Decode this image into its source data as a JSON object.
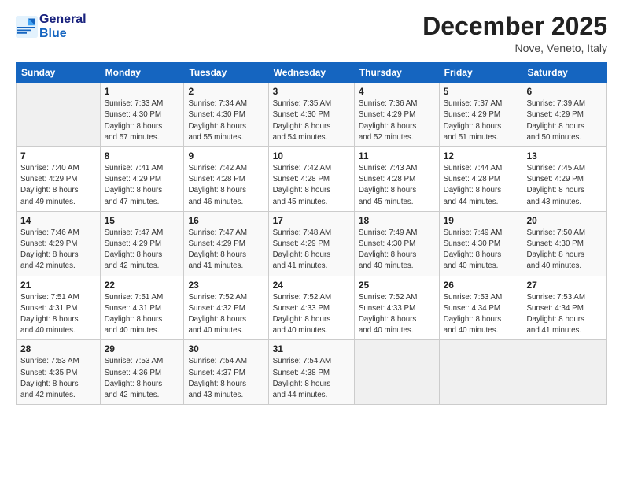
{
  "logo": {
    "line1": "General",
    "line2": "Blue"
  },
  "title": "December 2025",
  "location": "Nove, Veneto, Italy",
  "weekdays": [
    "Sunday",
    "Monday",
    "Tuesday",
    "Wednesday",
    "Thursday",
    "Friday",
    "Saturday"
  ],
  "weeks": [
    [
      {
        "day": "",
        "info": ""
      },
      {
        "day": "1",
        "info": "Sunrise: 7:33 AM\nSunset: 4:30 PM\nDaylight: 8 hours\nand 57 minutes."
      },
      {
        "day": "2",
        "info": "Sunrise: 7:34 AM\nSunset: 4:30 PM\nDaylight: 8 hours\nand 55 minutes."
      },
      {
        "day": "3",
        "info": "Sunrise: 7:35 AM\nSunset: 4:30 PM\nDaylight: 8 hours\nand 54 minutes."
      },
      {
        "day": "4",
        "info": "Sunrise: 7:36 AM\nSunset: 4:29 PM\nDaylight: 8 hours\nand 52 minutes."
      },
      {
        "day": "5",
        "info": "Sunrise: 7:37 AM\nSunset: 4:29 PM\nDaylight: 8 hours\nand 51 minutes."
      },
      {
        "day": "6",
        "info": "Sunrise: 7:39 AM\nSunset: 4:29 PM\nDaylight: 8 hours\nand 50 minutes."
      }
    ],
    [
      {
        "day": "7",
        "info": "Sunrise: 7:40 AM\nSunset: 4:29 PM\nDaylight: 8 hours\nand 49 minutes."
      },
      {
        "day": "8",
        "info": "Sunrise: 7:41 AM\nSunset: 4:29 PM\nDaylight: 8 hours\nand 47 minutes."
      },
      {
        "day": "9",
        "info": "Sunrise: 7:42 AM\nSunset: 4:28 PM\nDaylight: 8 hours\nand 46 minutes."
      },
      {
        "day": "10",
        "info": "Sunrise: 7:42 AM\nSunset: 4:28 PM\nDaylight: 8 hours\nand 45 minutes."
      },
      {
        "day": "11",
        "info": "Sunrise: 7:43 AM\nSunset: 4:28 PM\nDaylight: 8 hours\nand 45 minutes."
      },
      {
        "day": "12",
        "info": "Sunrise: 7:44 AM\nSunset: 4:28 PM\nDaylight: 8 hours\nand 44 minutes."
      },
      {
        "day": "13",
        "info": "Sunrise: 7:45 AM\nSunset: 4:29 PM\nDaylight: 8 hours\nand 43 minutes."
      }
    ],
    [
      {
        "day": "14",
        "info": "Sunrise: 7:46 AM\nSunset: 4:29 PM\nDaylight: 8 hours\nand 42 minutes."
      },
      {
        "day": "15",
        "info": "Sunrise: 7:47 AM\nSunset: 4:29 PM\nDaylight: 8 hours\nand 42 minutes."
      },
      {
        "day": "16",
        "info": "Sunrise: 7:47 AM\nSunset: 4:29 PM\nDaylight: 8 hours\nand 41 minutes."
      },
      {
        "day": "17",
        "info": "Sunrise: 7:48 AM\nSunset: 4:29 PM\nDaylight: 8 hours\nand 41 minutes."
      },
      {
        "day": "18",
        "info": "Sunrise: 7:49 AM\nSunset: 4:30 PM\nDaylight: 8 hours\nand 40 minutes."
      },
      {
        "day": "19",
        "info": "Sunrise: 7:49 AM\nSunset: 4:30 PM\nDaylight: 8 hours\nand 40 minutes."
      },
      {
        "day": "20",
        "info": "Sunrise: 7:50 AM\nSunset: 4:30 PM\nDaylight: 8 hours\nand 40 minutes."
      }
    ],
    [
      {
        "day": "21",
        "info": "Sunrise: 7:51 AM\nSunset: 4:31 PM\nDaylight: 8 hours\nand 40 minutes."
      },
      {
        "day": "22",
        "info": "Sunrise: 7:51 AM\nSunset: 4:31 PM\nDaylight: 8 hours\nand 40 minutes."
      },
      {
        "day": "23",
        "info": "Sunrise: 7:52 AM\nSunset: 4:32 PM\nDaylight: 8 hours\nand 40 minutes."
      },
      {
        "day": "24",
        "info": "Sunrise: 7:52 AM\nSunset: 4:33 PM\nDaylight: 8 hours\nand 40 minutes."
      },
      {
        "day": "25",
        "info": "Sunrise: 7:52 AM\nSunset: 4:33 PM\nDaylight: 8 hours\nand 40 minutes."
      },
      {
        "day": "26",
        "info": "Sunrise: 7:53 AM\nSunset: 4:34 PM\nDaylight: 8 hours\nand 40 minutes."
      },
      {
        "day": "27",
        "info": "Sunrise: 7:53 AM\nSunset: 4:34 PM\nDaylight: 8 hours\nand 41 minutes."
      }
    ],
    [
      {
        "day": "28",
        "info": "Sunrise: 7:53 AM\nSunset: 4:35 PM\nDaylight: 8 hours\nand 42 minutes."
      },
      {
        "day": "29",
        "info": "Sunrise: 7:53 AM\nSunset: 4:36 PM\nDaylight: 8 hours\nand 42 minutes."
      },
      {
        "day": "30",
        "info": "Sunrise: 7:54 AM\nSunset: 4:37 PM\nDaylight: 8 hours\nand 43 minutes."
      },
      {
        "day": "31",
        "info": "Sunrise: 7:54 AM\nSunset: 4:38 PM\nDaylight: 8 hours\nand 44 minutes."
      },
      {
        "day": "",
        "info": ""
      },
      {
        "day": "",
        "info": ""
      },
      {
        "day": "",
        "info": ""
      }
    ]
  ]
}
